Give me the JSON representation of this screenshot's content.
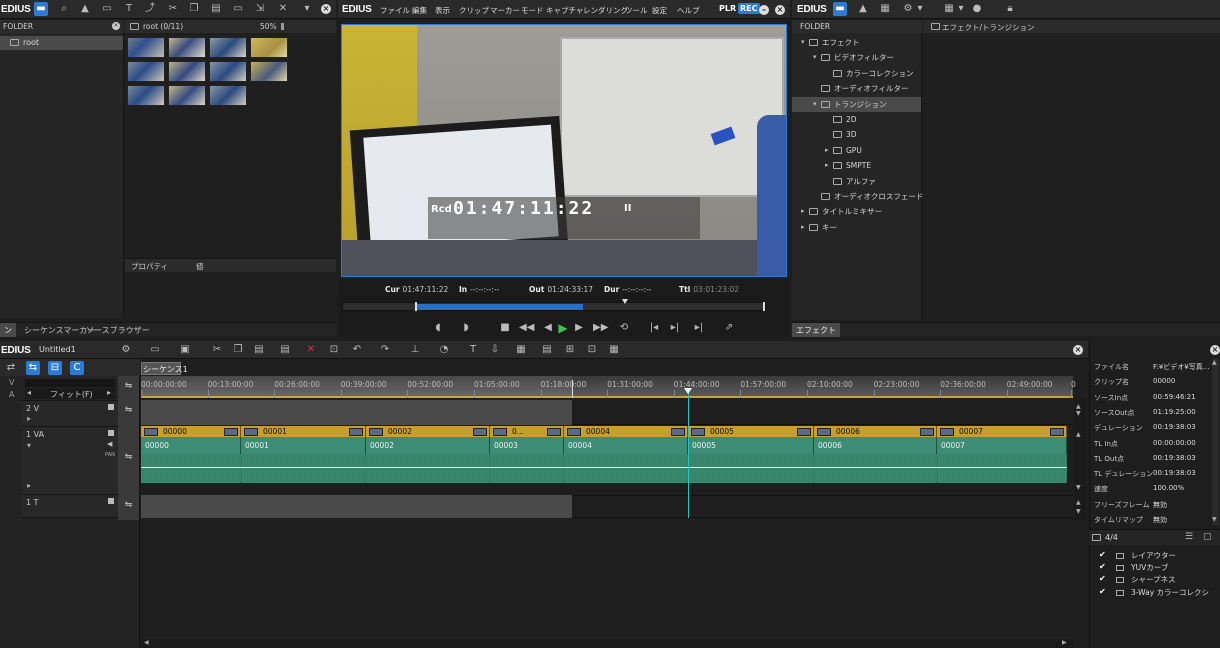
{
  "app": {
    "logo": "EDIUS"
  },
  "bin": {
    "folder_header": "FOLDER",
    "root_label": "root",
    "path_label": "root (0/11)",
    "zoom": "50%",
    "tab_labels": [
      "ン",
      "シーケンスマーカー",
      "ソースブラウザー"
    ],
    "property_cols": {
      "property": "プロパティ",
      "value": "値"
    }
  },
  "player": {
    "menu": [
      "ファイル",
      "編集",
      "表示",
      "クリップ",
      "マーカー",
      "モード",
      "キャプチャ",
      "レンダリング",
      "ツール",
      "設定",
      "ヘルプ"
    ],
    "plr": "PLR",
    "rec": "REC",
    "overlay": {
      "prefix": "Rcd",
      "timecode": "01:47:11:22",
      "pause": "II"
    },
    "timecodes": {
      "cur_label": "Cur",
      "cur": "01:47:11:22",
      "in_label": "In",
      "in": "--:--:--:--",
      "out_label": "Out",
      "out": "01:24:33:17",
      "dur_label": "Dur",
      "dur": "--:--:--:--",
      "ttl_label": "Ttl",
      "ttl": "03:01:23:02"
    },
    "scrub": {
      "fill_start": 0.175,
      "fill_end": 0.565,
      "marker": 0.665
    }
  },
  "effects": {
    "folder_header": "FOLDER",
    "path_label": "エフェクト/トランジション",
    "tab": "エフェクト",
    "tree": [
      {
        "label": "エフェクト",
        "level": 0,
        "expanded": true,
        "icon": "folder-fx-icon"
      },
      {
        "label": "ビデオフィルター",
        "level": 1,
        "expanded": true,
        "icon": "folder-fx-icon"
      },
      {
        "label": "カラーコレクション",
        "level": 2,
        "icon": "folder-icon"
      },
      {
        "label": "オーディオフィルター",
        "level": 1,
        "icon": "folder-icon"
      },
      {
        "label": "トランジション",
        "level": 1,
        "expanded": true,
        "selected": true,
        "icon": "folder-fx-icon"
      },
      {
        "label": "2D",
        "level": 2,
        "icon": "folder-icon"
      },
      {
        "label": "3D",
        "level": 2,
        "icon": "folder-icon"
      },
      {
        "label": "GPU",
        "level": 2,
        "collapsed": true,
        "icon": "folder-icon"
      },
      {
        "label": "SMPTE",
        "level": 2,
        "collapsed": true,
        "icon": "folder-icon"
      },
      {
        "label": "アルファ",
        "level": 2,
        "icon": "folder-icon"
      },
      {
        "label": "オーディオクロスフェード",
        "level": 1,
        "icon": "folder-icon"
      },
      {
        "label": "タイトルミキサー",
        "level": 0,
        "collapsed": true,
        "icon": "folder-icon"
      },
      {
        "label": "キー",
        "level": 0,
        "collapsed": true,
        "icon": "folder-icon"
      }
    ]
  },
  "timeline": {
    "project": "Untitled1",
    "sequence_tab": "シーケンス1",
    "fit_label": "フィット(F)",
    "ruler": [
      "00:00:00:00",
      "00:13:00:00",
      "00:26:00:00",
      "00:39:00:00",
      "00:52:00:00",
      "01:05:00:00",
      "01:18:00:00",
      "01:31:00:00",
      "01:44:00:00",
      "01:57:00:00",
      "02:10:00:00",
      "02:23:00:00",
      "02:36:00:00",
      "02:49:00:00",
      "0"
    ],
    "tracks": {
      "v2": "2 V",
      "va1": "1 VA",
      "t1": "1 T",
      "v_short": "V",
      "a_short": "A",
      "pan": "PAN"
    },
    "clips": [
      {
        "name": "00000",
        "sub": "00000"
      },
      {
        "name": "00001",
        "sub": "00001"
      },
      {
        "name": "00002",
        "sub": "00002"
      },
      {
        "name": "0...",
        "sub": "00003"
      },
      {
        "name": "00004",
        "sub": "00004"
      },
      {
        "name": "00005",
        "sub": "00005"
      },
      {
        "name": "00006",
        "sub": "00006"
      },
      {
        "name": "00007",
        "sub": "00007"
      }
    ]
  },
  "properties": {
    "rows": [
      {
        "k": "ファイル名",
        "v": "F:¥ビデオ¥写真..."
      },
      {
        "k": "クリップ名",
        "v": "00000"
      },
      {
        "k": "ソースIn点",
        "v": "00:59:46:21"
      },
      {
        "k": "ソースOut点",
        "v": "01:19:25:00"
      },
      {
        "k": "デュレーション",
        "v": "00:19:38:03"
      },
      {
        "k": "TL In点",
        "v": "00:00:00:00"
      },
      {
        "k": "TL Out点",
        "v": "00:19:38:03"
      },
      {
        "k": "TL デュレーション",
        "v": "00:19:38:03"
      },
      {
        "k": "速度",
        "v": "100.00%"
      },
      {
        "k": "フリーズフレーム",
        "v": "無効"
      },
      {
        "k": "タイムリマップ",
        "v": "無効"
      }
    ],
    "count": "4/4",
    "layers": [
      "レイアウター",
      "YUVカーブ",
      "シャープネス",
      "3-Way カラーコレクシ"
    ]
  }
}
